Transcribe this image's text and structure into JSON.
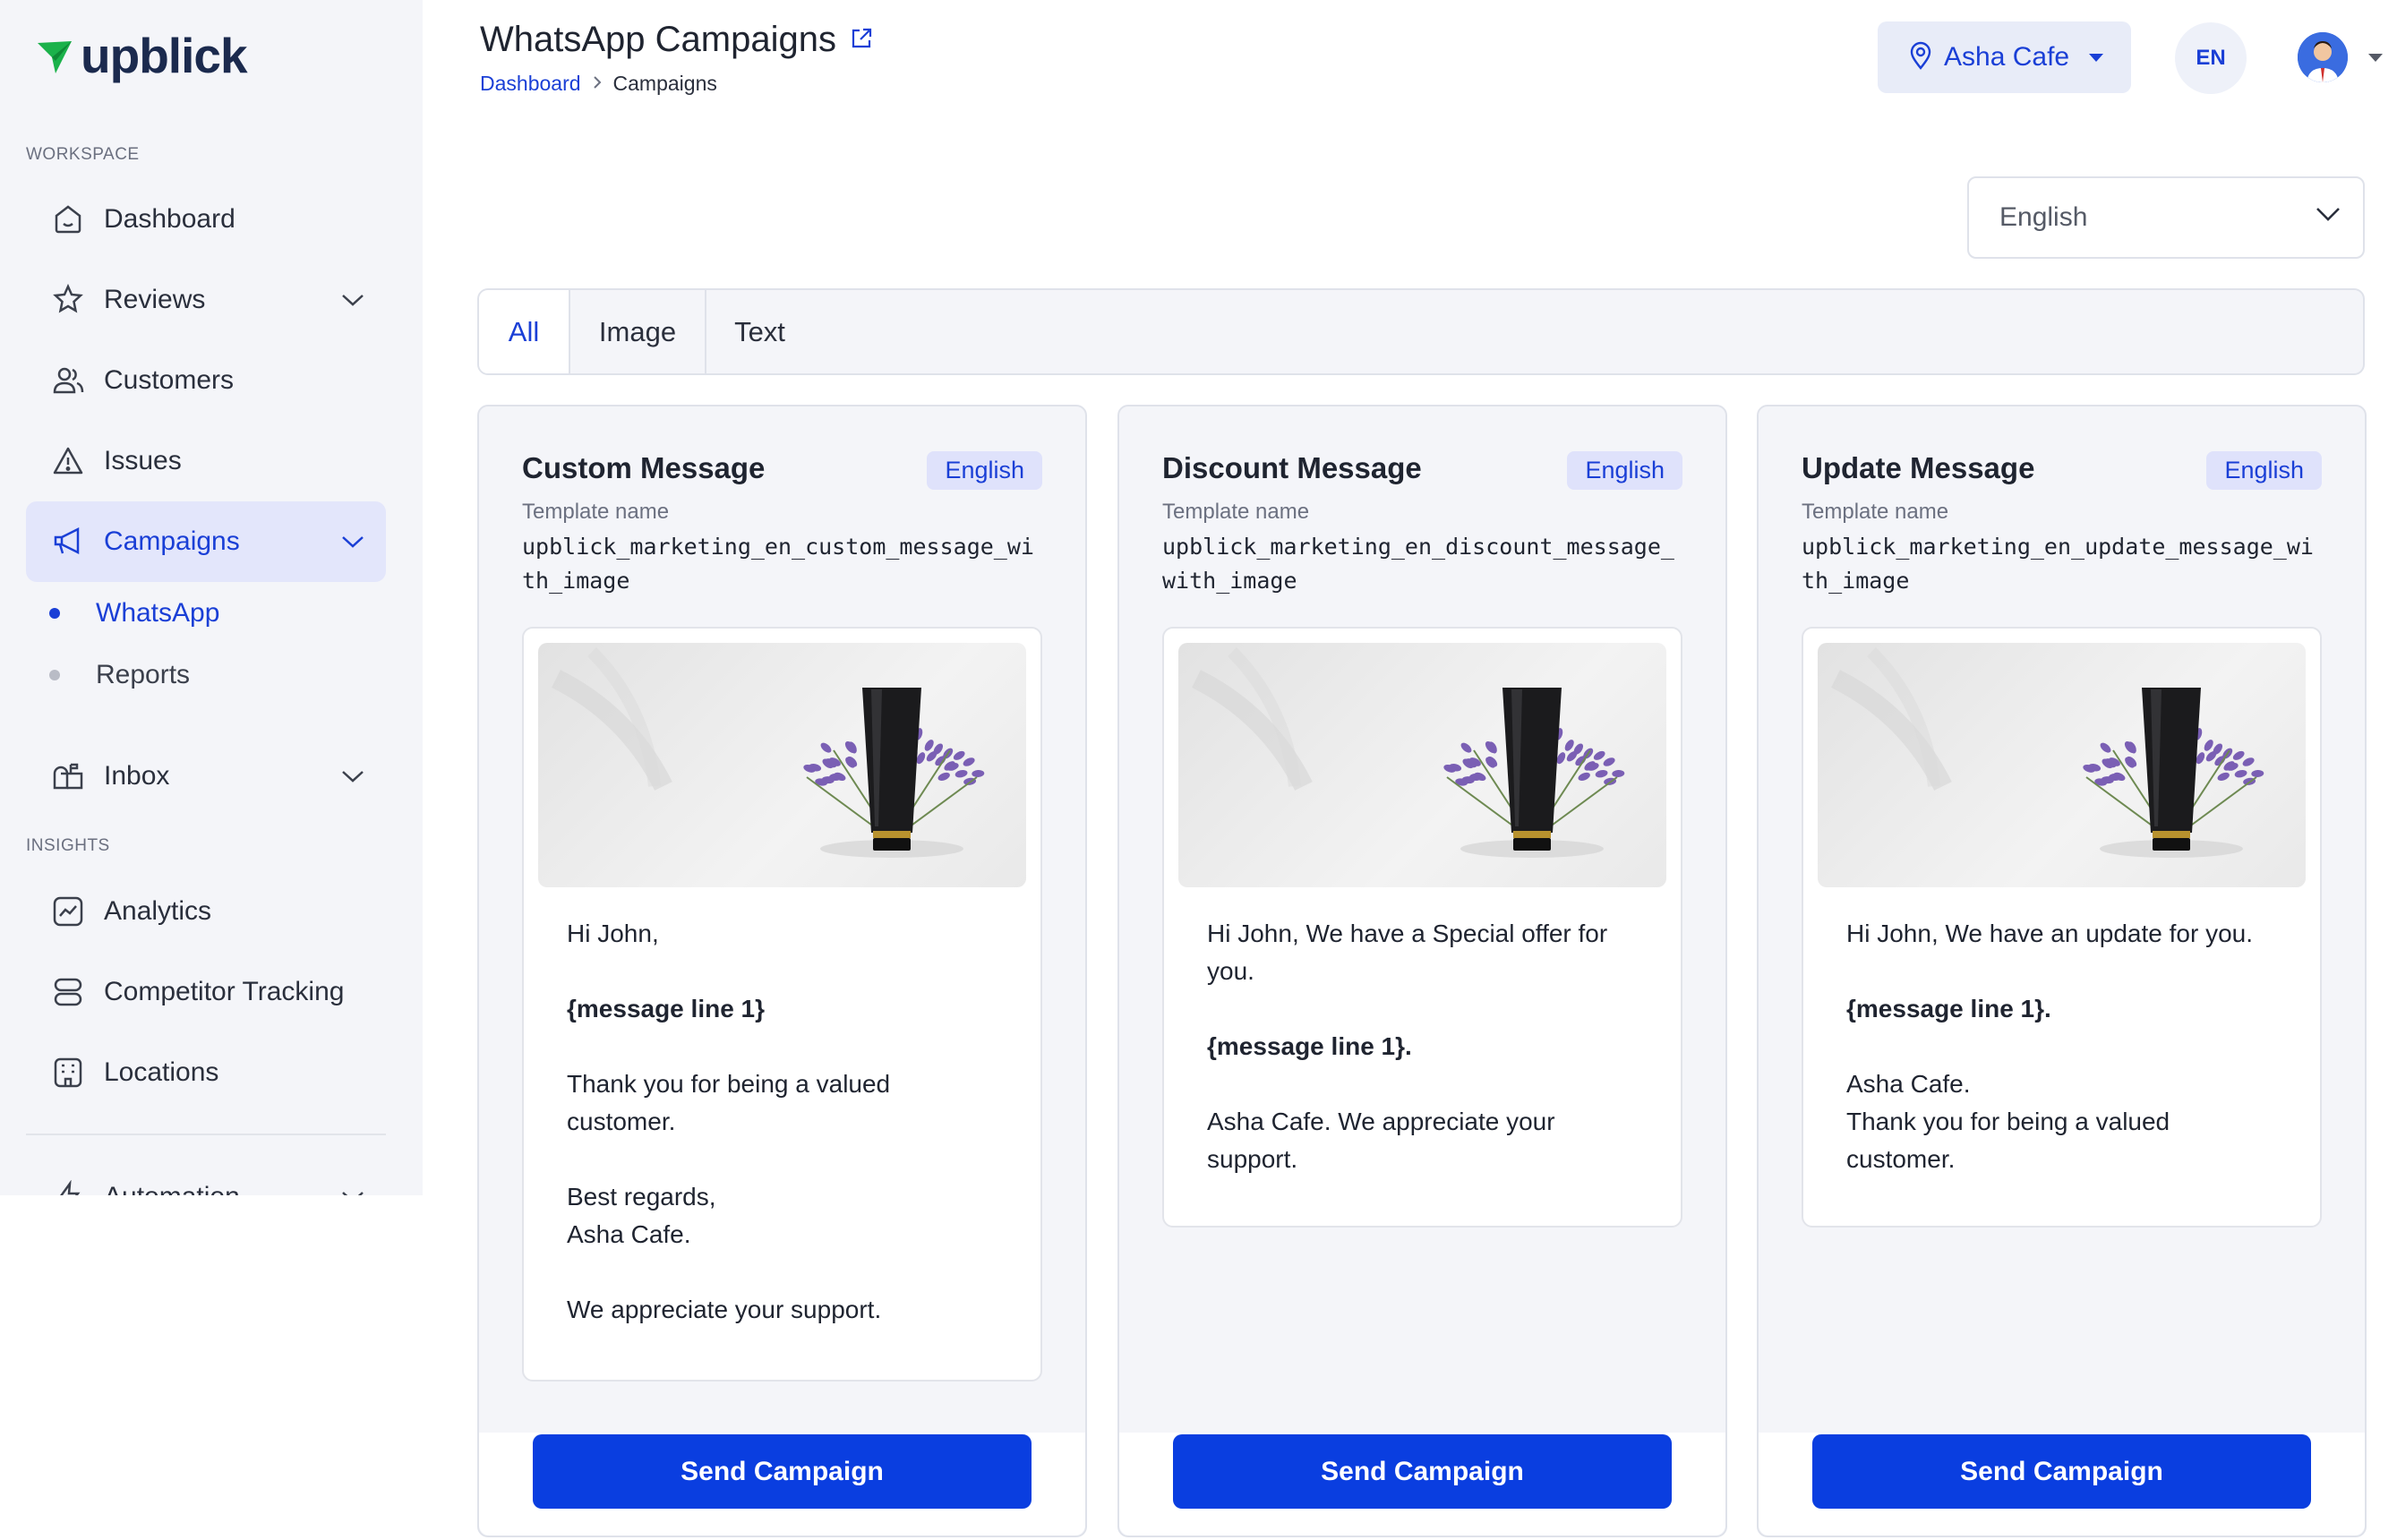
{
  "app": {
    "brand": "upblick"
  },
  "sidebar": {
    "workspace_label": "WORKSPACE",
    "insights_label": "INSIGHTS",
    "items": [
      {
        "label": "Dashboard",
        "icon": "home-icon"
      },
      {
        "label": "Reviews",
        "icon": "star-badge-icon"
      },
      {
        "label": "Customers",
        "icon": "users-icon"
      },
      {
        "label": "Issues",
        "icon": "warning-icon"
      },
      {
        "label": "Campaigns",
        "icon": "megaphone-icon"
      },
      {
        "label": "Inbox",
        "icon": "mailbox-icon"
      },
      {
        "label": "Analytics",
        "icon": "chart-icon"
      },
      {
        "label": "Competitor Tracking",
        "icon": "server-icon"
      },
      {
        "label": "Locations",
        "icon": "building-icon"
      },
      {
        "label": "Automation",
        "icon": "bolt-icon"
      }
    ],
    "sub_items": [
      {
        "label": "WhatsApp"
      },
      {
        "label": "Reports"
      }
    ]
  },
  "header": {
    "title": "WhatsApp Campaigns",
    "breadcrumb": {
      "link": "Dashboard",
      "current": "Campaigns"
    },
    "location": "Asha Cafe",
    "lang_code": "EN"
  },
  "language_select": {
    "value": "English"
  },
  "tabs": [
    {
      "label": "All"
    },
    {
      "label": "Image"
    },
    {
      "label": "Text"
    }
  ],
  "cards": [
    {
      "title": "Custom Message",
      "badge": "English",
      "template_label": "Template name",
      "template_name": "upblick_marketing_en_custom_message_with_image",
      "lines": [
        "Hi John,",
        "",
        "{message line 1}",
        "",
        "Thank you for being a valued customer.",
        "",
        "Best regards,",
        "Asha Cafe.",
        "",
        "We appreciate your support."
      ],
      "button": "Send Campaign"
    },
    {
      "title": "Discount Message",
      "badge": "English",
      "template_label": "Template name",
      "template_name": "upblick_marketing_en_discount_message_with_image",
      "lines": [
        "Hi John, We have a Special offer for you.",
        "",
        "{message line 1}.",
        "",
        "Asha Cafe. We appreciate your support."
      ],
      "button": "Send Campaign"
    },
    {
      "title": "Update Message",
      "badge": "English",
      "template_label": "Template name",
      "template_name": "upblick_marketing_en_update_message_with_image",
      "lines": [
        "Hi John, We have an update for you.",
        "",
        "{message line 1}.",
        "",
        "Asha Cafe.",
        "Thank you for being a valued customer."
      ],
      "button": "Send Campaign"
    }
  ],
  "colors": {
    "accent": "#1a3fd6",
    "button": "#0a3ee0",
    "sidebar_bg": "#f4f5f9"
  }
}
